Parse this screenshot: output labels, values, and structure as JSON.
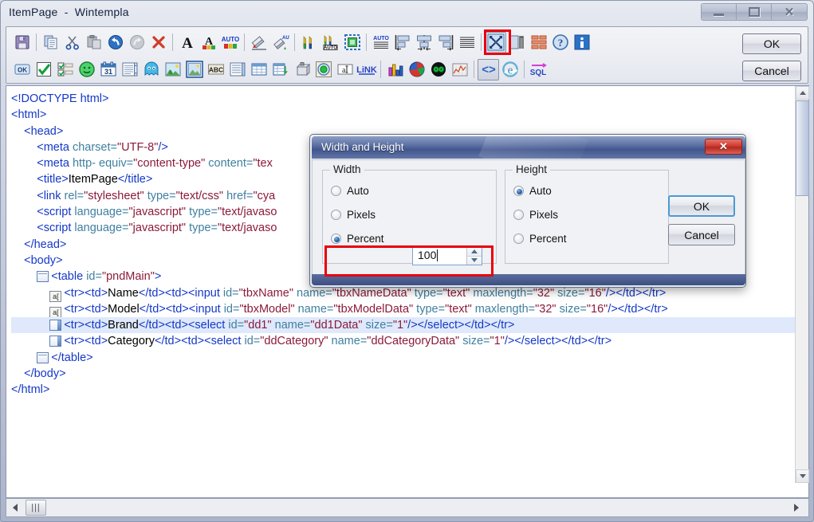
{
  "window": {
    "title": "ItemPage  -  Wintempla",
    "buttons": {
      "minimize": "minimize-button",
      "maximize": "maximize-button",
      "close": "✕"
    }
  },
  "toolbar": {
    "ok_label": "OK",
    "cancel_label": "Cancel",
    "row1": [
      {
        "name": "save-icon",
        "sep_after": true
      },
      {
        "name": "copy-icon"
      },
      {
        "name": "cut-icon"
      },
      {
        "name": "paste-icon"
      },
      {
        "name": "undo-icon"
      },
      {
        "name": "redo-icon"
      },
      {
        "name": "delete-icon",
        "sep_after": true
      },
      {
        "name": "font-icon"
      },
      {
        "name": "font-color-icon"
      },
      {
        "name": "auto-font-color-icon",
        "sep_after": true
      },
      {
        "name": "fill-color-icon"
      },
      {
        "name": "auto-fill-color-icon",
        "sep_after": true
      },
      {
        "name": "border-color-icon"
      },
      {
        "name": "auto-border-color-icon"
      },
      {
        "name": "border-style-icon",
        "sep_after": true
      },
      {
        "name": "auto-text-align-icon"
      },
      {
        "name": "align-left-icon"
      },
      {
        "name": "align-center-icon"
      },
      {
        "name": "align-right-icon"
      },
      {
        "name": "align-justify-icon",
        "sep_after": true
      },
      {
        "name": "width-and-height-icon",
        "highlighted": true
      },
      {
        "name": "margin-icon"
      },
      {
        "name": "padding-icon"
      },
      {
        "name": "help-icon"
      },
      {
        "name": "info-icon"
      }
    ],
    "row2": [
      {
        "name": "button-ok-icon"
      },
      {
        "name": "checkbox-icon"
      },
      {
        "name": "checkbox-list-icon"
      },
      {
        "name": "smiley-icon"
      },
      {
        "name": "calendar-icon"
      },
      {
        "name": "listbox-icon"
      },
      {
        "name": "ghost-icon"
      },
      {
        "name": "image-icon"
      },
      {
        "name": "picture-box-icon"
      },
      {
        "name": "abc-label-icon"
      },
      {
        "name": "listview-icon"
      },
      {
        "name": "grid-icon"
      },
      {
        "name": "data-grid-icon"
      },
      {
        "name": "database-icon"
      },
      {
        "name": "radio-button-icon"
      },
      {
        "name": "textbox-icon"
      },
      {
        "name": "link-icon",
        "sep_after": true
      },
      {
        "name": "bar-chart-icon"
      },
      {
        "name": "pie-chart-icon"
      },
      {
        "name": "scatter-chart-icon"
      },
      {
        "name": "line-chart-icon",
        "sep_after": true
      },
      {
        "name": "html-source-icon",
        "pressed": true
      },
      {
        "name": "browser-icon",
        "sep_after": true
      },
      {
        "name": "sql-icon"
      }
    ]
  },
  "editor": {
    "lines": [
      {
        "indent": 0,
        "icon": null,
        "parts": [
          {
            "c": "tag",
            "t": "<!DOCTYPE html>"
          }
        ]
      },
      {
        "indent": 0,
        "icon": null,
        "parts": [
          {
            "c": "tag",
            "t": "<html>"
          }
        ]
      },
      {
        "indent": 1,
        "icon": null,
        "parts": [
          {
            "c": "tag",
            "t": "<head>"
          }
        ]
      },
      {
        "indent": 2,
        "icon": null,
        "parts": [
          {
            "c": "tag",
            "t": "<meta "
          },
          {
            "c": "attr",
            "t": "charset="
          },
          {
            "c": "val",
            "t": "\"UTF-8\""
          },
          {
            "c": "tag",
            "t": "/>"
          }
        ]
      },
      {
        "indent": 2,
        "icon": null,
        "parts": [
          {
            "c": "tag",
            "t": "<meta "
          },
          {
            "c": "attr",
            "t": "http- equiv="
          },
          {
            "c": "val",
            "t": "\"content-type\""
          },
          {
            "c": "attr",
            "t": " content="
          },
          {
            "c": "val",
            "t": "\"tex"
          }
        ]
      },
      {
        "indent": 2,
        "icon": null,
        "parts": [
          {
            "c": "tag",
            "t": "<title>"
          },
          {
            "c": "txt",
            "t": "ItemPage"
          },
          {
            "c": "tag",
            "t": "</title>"
          }
        ]
      },
      {
        "indent": 2,
        "icon": null,
        "parts": [
          {
            "c": "tag",
            "t": "<link "
          },
          {
            "c": "attr",
            "t": "rel="
          },
          {
            "c": "val",
            "t": "\"stylesheet\""
          },
          {
            "c": "attr",
            "t": " type="
          },
          {
            "c": "val",
            "t": "\"text/css\""
          },
          {
            "c": "attr",
            "t": " href="
          },
          {
            "c": "val",
            "t": "\"cya"
          }
        ]
      },
      {
        "indent": 2,
        "icon": null,
        "parts": [
          {
            "c": "tag",
            "t": "<script "
          },
          {
            "c": "attr",
            "t": "language="
          },
          {
            "c": "val",
            "t": "\"javascript\""
          },
          {
            "c": "attr",
            "t": " type="
          },
          {
            "c": "val",
            "t": "\"text/javaso"
          }
        ]
      },
      {
        "indent": 2,
        "icon": null,
        "parts": [
          {
            "c": "tag",
            "t": "<script "
          },
          {
            "c": "attr",
            "t": "language="
          },
          {
            "c": "val",
            "t": "\"javascript\""
          },
          {
            "c": "attr",
            "t": " type="
          },
          {
            "c": "val",
            "t": "\"text/javaso"
          }
        ]
      },
      {
        "indent": 1,
        "icon": null,
        "parts": [
          {
            "c": "tag",
            "t": "</head>"
          }
        ]
      },
      {
        "indent": 1,
        "icon": null,
        "parts": [
          {
            "c": "tag",
            "t": "<body>"
          }
        ]
      },
      {
        "indent": 2,
        "icon": "table-open-icon",
        "parts": [
          {
            "c": "tag",
            "t": "<table "
          },
          {
            "c": "attr",
            "t": "id="
          },
          {
            "c": "val",
            "t": "\"pndMain\""
          },
          {
            "c": "tag",
            "t": ">"
          }
        ]
      },
      {
        "indent": 3,
        "icon": "textbox-row-icon",
        "parts": [
          {
            "c": "tag",
            "t": "<tr><td>"
          },
          {
            "c": "txt",
            "t": "Name"
          },
          {
            "c": "tag",
            "t": "</td><td><input "
          },
          {
            "c": "attr",
            "t": "id="
          },
          {
            "c": "val",
            "t": "\"tbxName\""
          },
          {
            "c": "attr",
            "t": " name="
          },
          {
            "c": "val",
            "t": "\"tbxNameData\""
          },
          {
            "c": "attr",
            "t": " type="
          },
          {
            "c": "val",
            "t": "\"text\""
          },
          {
            "c": "attr",
            "t": " maxlength="
          },
          {
            "c": "val",
            "t": "\"32\""
          },
          {
            "c": "attr",
            "t": " size="
          },
          {
            "c": "val",
            "t": "\"16\""
          },
          {
            "c": "tag",
            "t": "/></td></tr>"
          }
        ]
      },
      {
        "indent": 3,
        "icon": "textbox-row-icon",
        "parts": [
          {
            "c": "tag",
            "t": "<tr><td>"
          },
          {
            "c": "txt",
            "t": "Model"
          },
          {
            "c": "tag",
            "t": "</td><td><input "
          },
          {
            "c": "attr",
            "t": "id="
          },
          {
            "c": "val",
            "t": "\"tbxModel\""
          },
          {
            "c": "attr",
            "t": " name="
          },
          {
            "c": "val",
            "t": "\"tbxModelData\""
          },
          {
            "c": "attr",
            "t": " type="
          },
          {
            "c": "val",
            "t": "\"text\""
          },
          {
            "c": "attr",
            "t": " maxlength="
          },
          {
            "c": "val",
            "t": "\"32\""
          },
          {
            "c": "attr",
            "t": " size="
          },
          {
            "c": "val",
            "t": "\"16\""
          },
          {
            "c": "tag",
            "t": "/></td></tr>"
          }
        ]
      },
      {
        "indent": 3,
        "icon": "select-row-icon",
        "selected": true,
        "parts": [
          {
            "c": "tag",
            "t": "<tr><td>"
          },
          {
            "c": "txt",
            "t": "Brand"
          },
          {
            "c": "tag",
            "t": "</td><td><select "
          },
          {
            "c": "attr",
            "t": "id="
          },
          {
            "c": "val",
            "t": "\"dd1\""
          },
          {
            "c": "attr",
            "t": " name="
          },
          {
            "c": "val",
            "t": "\"dd1Data\""
          },
          {
            "c": "attr",
            "t": " size="
          },
          {
            "c": "val",
            "t": "\"1\""
          },
          {
            "c": "tag",
            "t": "/></select></td></tr>"
          }
        ]
      },
      {
        "indent": 3,
        "icon": "select-row-icon",
        "parts": [
          {
            "c": "tag",
            "t": "<tr><td>"
          },
          {
            "c": "txt",
            "t": "Category"
          },
          {
            "c": "tag",
            "t": "</td><td><select "
          },
          {
            "c": "attr",
            "t": "id="
          },
          {
            "c": "val",
            "t": "\"ddCategory\""
          },
          {
            "c": "attr",
            "t": " name="
          },
          {
            "c": "val",
            "t": "\"ddCategoryData\""
          },
          {
            "c": "attr",
            "t": " size="
          },
          {
            "c": "val",
            "t": "\"1\""
          },
          {
            "c": "tag",
            "t": "/></select></td></tr>"
          }
        ]
      },
      {
        "indent": 2,
        "icon": "table-close-icon",
        "parts": [
          {
            "c": "tag",
            "t": "</table>"
          }
        ]
      },
      {
        "indent": 1,
        "icon": null,
        "parts": [
          {
            "c": "tag",
            "t": "</body>"
          }
        ]
      },
      {
        "indent": 0,
        "icon": null,
        "parts": [
          {
            "c": "tag",
            "t": "</html>"
          }
        ]
      }
    ]
  },
  "dialog": {
    "title": "Width and Height",
    "close_label": "✕",
    "width_group": {
      "label": "Width",
      "options": [
        "Auto",
        "Pixels",
        "Percent"
      ],
      "selected": "Percent",
      "value": "100"
    },
    "height_group": {
      "label": "Height",
      "options": [
        "Auto",
        "Pixels",
        "Percent"
      ],
      "selected": "Auto"
    },
    "ok_label": "OK",
    "cancel_label": "Cancel"
  },
  "colors": {
    "highlight_red": "#e8000d",
    "dialog_title_blue": "#42568d",
    "code_tag_blue": "#1438c8",
    "code_attr_teal": "#3f7f9f",
    "code_value_maroon": "#8b1a3a",
    "selection_blue": "#dfe9fb"
  },
  "status": {
    "hscroll_thumb": "|||"
  }
}
